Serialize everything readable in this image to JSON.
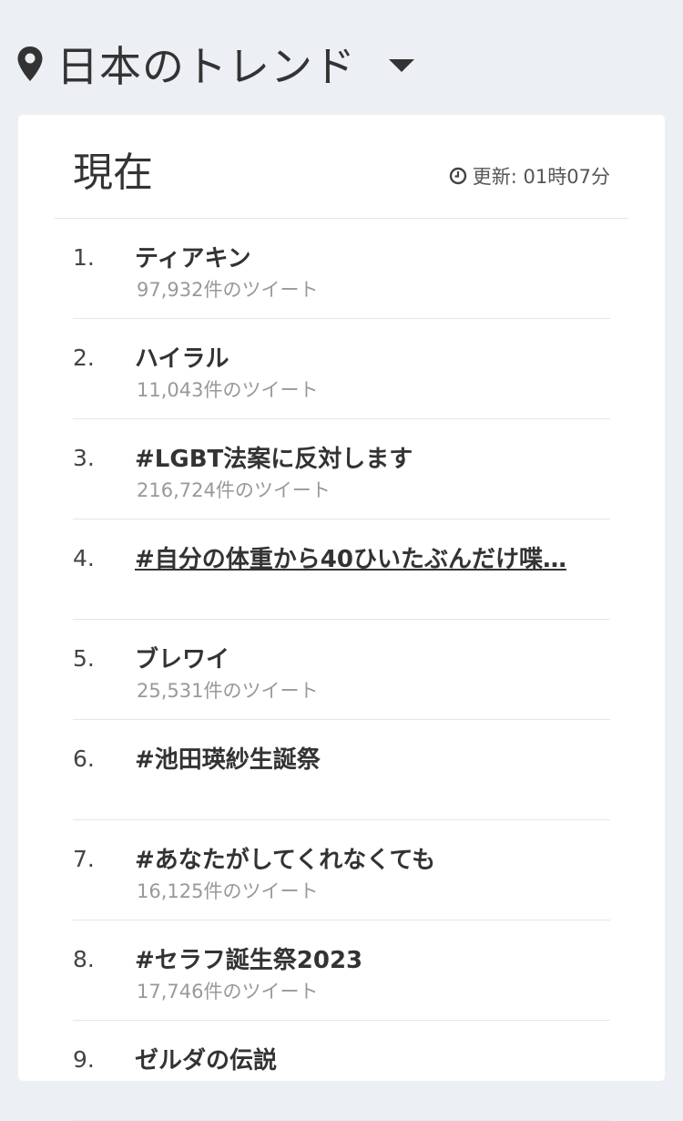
{
  "header": {
    "title": "日本のトレンド"
  },
  "card": {
    "title": "現在",
    "updated": "更新: 01時07分"
  },
  "trends": [
    {
      "rank": "1.",
      "name": "ティアキン",
      "count": "97,932件のツイート"
    },
    {
      "rank": "2.",
      "name": "ハイラル",
      "count": "11,043件のツイート"
    },
    {
      "rank": "3.",
      "name": "#LGBT法案に反対します",
      "count": "216,724件のツイート"
    },
    {
      "rank": "4.",
      "name": "#自分の体重から40ひいたぶんだけ喋…",
      "count": ""
    },
    {
      "rank": "5.",
      "name": "ブレワイ",
      "count": "25,531件のツイート"
    },
    {
      "rank": "6.",
      "name": "#池田瑛紗生誕祭",
      "count": ""
    },
    {
      "rank": "7.",
      "name": "#あなたがしてくれなくても",
      "count": "16,125件のツイート"
    },
    {
      "rank": "8.",
      "name": "#セラフ誕生祭2023",
      "count": "17,746件のツイート"
    },
    {
      "rank": "9.",
      "name": "ゼルダの伝説",
      "count": ""
    }
  ],
  "icons": {
    "location": "map-pin-icon",
    "dropdown": "caret-down-icon",
    "clock": "clock-icon"
  },
  "colors": {
    "background": "#eceff3",
    "card": "#ffffff",
    "text": "#333333",
    "muted": "#999999"
  }
}
